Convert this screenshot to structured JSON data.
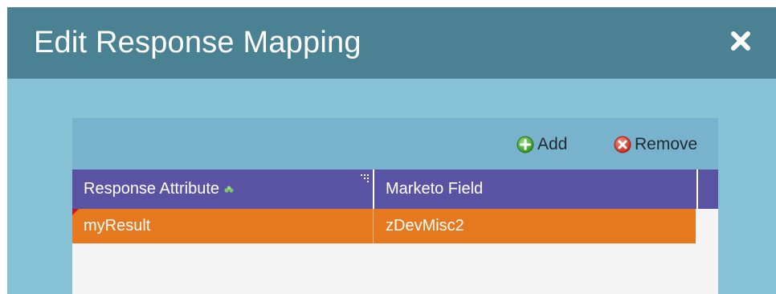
{
  "dialog": {
    "title": "Edit Response Mapping",
    "close_icon": "close-icon"
  },
  "toolbar": {
    "add_label": "Add",
    "add_icon": "plus-circle-icon",
    "remove_label": "Remove",
    "remove_icon": "x-circle-icon"
  },
  "table": {
    "columns": [
      "Response Attribute",
      "Marketo Field"
    ],
    "rows": [
      [
        "myResult",
        "zDevMisc2"
      ]
    ]
  },
  "colors": {
    "titlebar": "#4a8294",
    "background": "#87c1d6",
    "toolbar": "#78b2cd",
    "header": "#5a52a3",
    "selected_row": "#e6791f"
  }
}
